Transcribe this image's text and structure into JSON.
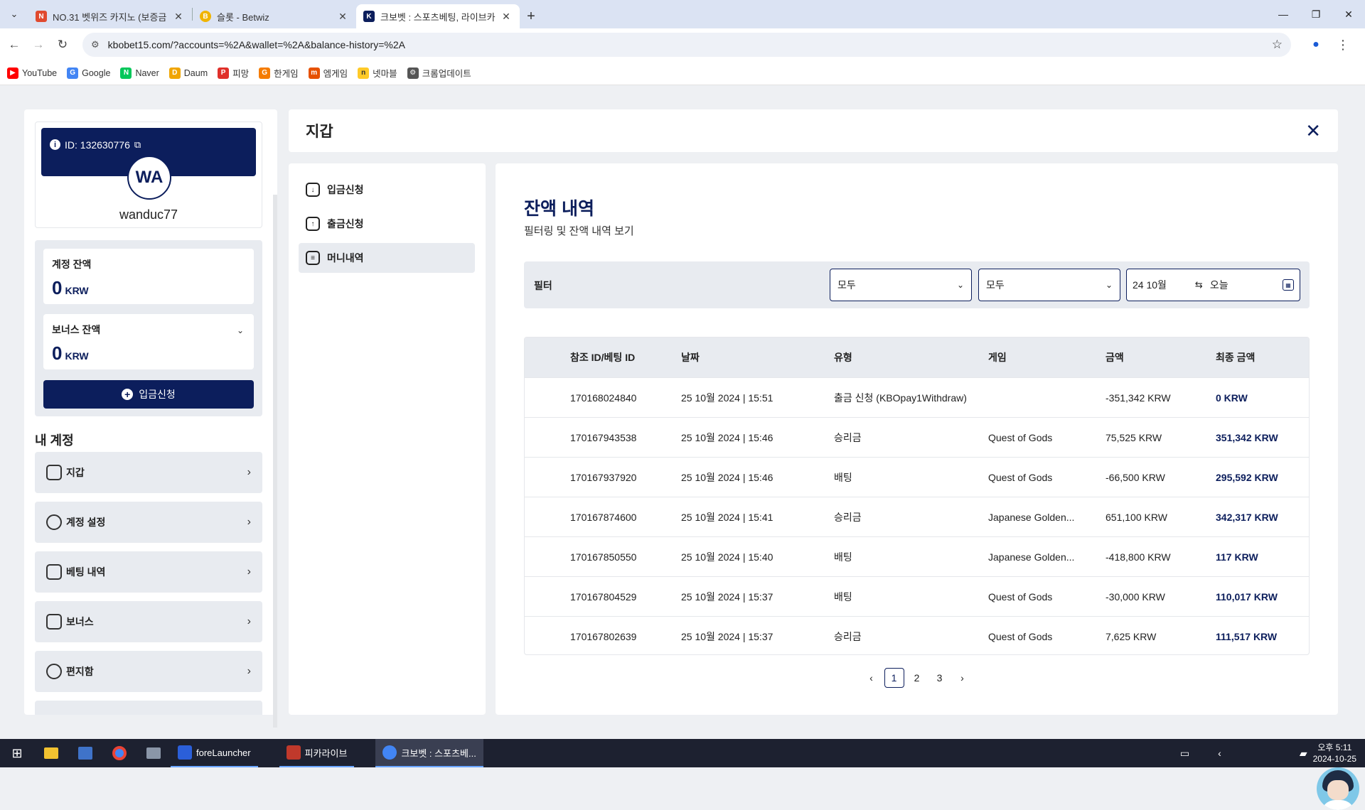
{
  "browser": {
    "tabs": [
      {
        "title": "NO.31 벳위즈 카지노 (보증금",
        "icon_color": "#e04a2f",
        "active": false
      },
      {
        "title": "슬롯 - Betwiz",
        "icon_color": "#f0b400",
        "active": false
      },
      {
        "title": "크보벳 : 스포츠베팅, 라이브카",
        "icon_color": "#0c1e5c",
        "active": true
      }
    ],
    "url": "kbobet15.com/?accounts=%2A&wallet=%2A&balance-history=%2A",
    "bookmarks": [
      {
        "label": "YouTube",
        "color": "#ff0000"
      },
      {
        "label": "Google",
        "color": "#4285f4"
      },
      {
        "label": "Naver",
        "color": "#03c75a"
      },
      {
        "label": "Daum",
        "color": "#f0a500"
      },
      {
        "label": "피망",
        "color": "#e0302a"
      },
      {
        "label": "한게임",
        "color": "#f57c00"
      },
      {
        "label": "엠게임",
        "color": "#e65100"
      },
      {
        "label": "넷마블",
        "color": "#ffca28"
      },
      {
        "label": "크롬업데이트",
        "color": "#555555"
      }
    ]
  },
  "sidebar": {
    "id_label": "ID: 132630776",
    "avatar_initials": "WA",
    "username": "wanduc77",
    "account_balance": {
      "label": "계정 잔액",
      "amount": "0",
      "currency": "KRW"
    },
    "bonus_balance": {
      "label": "보너스 잔액",
      "amount": "0",
      "currency": "KRW"
    },
    "deposit_button": "입금신청",
    "my_account_title": "내 계정",
    "menu": [
      {
        "label": "지갑",
        "icon": "wallet-icon"
      },
      {
        "label": "계정 설정",
        "icon": "user-settings-icon"
      },
      {
        "label": "베팅 내역",
        "icon": "receipt-icon"
      },
      {
        "label": "보너스",
        "icon": "gift-icon"
      },
      {
        "label": "편지함",
        "icon": "messages-icon"
      }
    ]
  },
  "wallet": {
    "title": "지갑",
    "submenu": [
      {
        "label": "입금신청",
        "icon": "deposit-icon"
      },
      {
        "label": "출금신청",
        "icon": "withdraw-icon"
      },
      {
        "label": "머니내역",
        "icon": "history-icon"
      }
    ],
    "content_title": "잔액 내역",
    "content_subtitle": "필터링 및 잔액 내역 보기",
    "filter": {
      "label": "필터",
      "select1": "모두",
      "select2": "모두",
      "date_from": "24 10월",
      "date_to": "오늘"
    },
    "table": {
      "headers": [
        "참조 ID/베팅 ID",
        "날짜",
        "유형",
        "게임",
        "금액",
        "최종 금액"
      ],
      "rows": [
        [
          "170168024840",
          "25 10월 2024 | 15:51",
          "출금 신청 (KBOpay1Withdraw)",
          "",
          "-351,342 KRW",
          "0 KRW"
        ],
        [
          "170167943538",
          "25 10월 2024 | 15:46",
          "승리금",
          "Quest of Gods",
          "75,525 KRW",
          "351,342 KRW"
        ],
        [
          "170167937920",
          "25 10월 2024 | 15:46",
          "배팅",
          "Quest of Gods",
          "-66,500 KRW",
          "295,592 KRW"
        ],
        [
          "170167874600",
          "25 10월 2024 | 15:41",
          "승리금",
          "Japanese Golden...",
          "651,100 KRW",
          "342,317 KRW"
        ],
        [
          "170167850550",
          "25 10월 2024 | 15:40",
          "배팅",
          "Japanese Golden...",
          "-418,800 KRW",
          "117 KRW"
        ],
        [
          "170167804529",
          "25 10월 2024 | 15:37",
          "배팅",
          "Quest of Gods",
          "-30,000 KRW",
          "110,017 KRW"
        ],
        [
          "170167802639",
          "25 10월 2024 | 15:37",
          "승리금",
          "Quest of Gods",
          "7,625 KRW",
          "111,517 KRW"
        ]
      ]
    },
    "pagination": {
      "pages": [
        "1",
        "2",
        "3"
      ],
      "current": "1",
      "prev": "‹",
      "next": "›"
    }
  },
  "taskbar": {
    "apps": [
      {
        "label": "foreLauncher",
        "color": "#2b5fd9"
      },
      {
        "label": "피카라이브",
        "color": "#c0392b"
      },
      {
        "label": "크보벳 : 스포츠베...",
        "color": "#4285f4"
      }
    ],
    "time": "오후 5:11",
    "date": "2024-10-25"
  }
}
